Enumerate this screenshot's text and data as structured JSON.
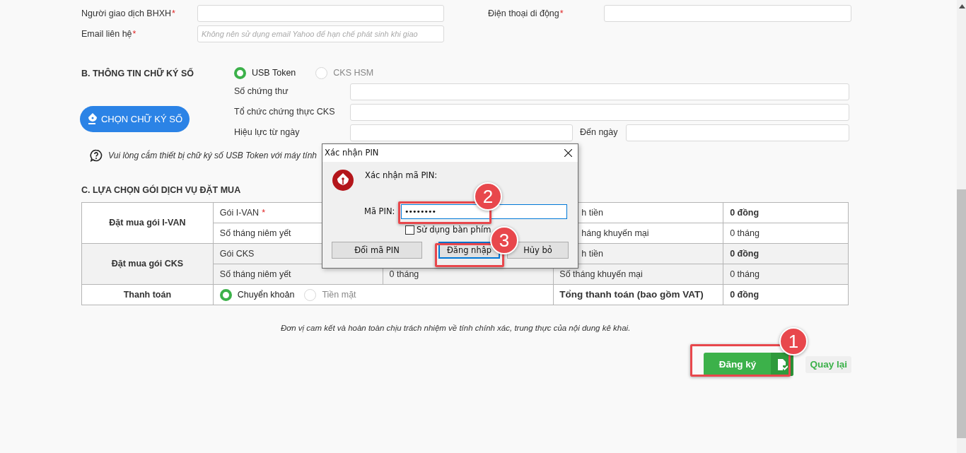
{
  "contact": {
    "fields": [
      {
        "label": "Người giao dịch BHXH",
        "mark": "*"
      },
      {
        "label": "Điện thoại di động",
        "mark": "*"
      },
      {
        "label": "Email liên hệ",
        "mark": "*",
        "placeholder": "Không nên sử dụng email Yahoo để hạn chế phát sinh khi giao"
      }
    ]
  },
  "signature": {
    "title": "B. THÔNG TIN CHỮ KÝ SỐ",
    "options": [
      {
        "label": "USB Token",
        "selected": true
      },
      {
        "label": "CKS HSM",
        "selected": false
      }
    ],
    "choose_button": "CHỌN CHỮ KÝ SỐ",
    "fields": [
      "Số chứng thư",
      "Tổ chức chứng thực CKS",
      "Hiệu lực từ ngày"
    ],
    "to_label": "Đến ngày",
    "note": "Vui lòng cắm thiết bị chữ ký số USB Token với máy tính"
  },
  "packages": {
    "title": "C. LỰA CHỌN GÓI DỊCH VỤ ĐẶT MUA",
    "groups": [
      {
        "title": "Đặt mua gói I-VAN",
        "lines": [
          {
            "label": "Gói I-VAN",
            "mark": "*",
            "label_2": "h tiền",
            "value_2": "0 đồng",
            "kind": "money"
          },
          {
            "label": "Số tháng niêm yết",
            "label_2": "háng khuyến mại",
            "value_2": "0 tháng",
            "kind": "months"
          }
        ]
      },
      {
        "title": "Đặt mua gói CKS",
        "lines": [
          {
            "label": "Gói CKS",
            "label_2": "h tiền",
            "value_2": "0 đồng",
            "kind": "money"
          },
          {
            "label": "Số tháng niêm yết",
            "value": "0 tháng",
            "label_2": "Số tháng khuyến mại",
            "value_2": "0 tháng",
            "kind": "months"
          }
        ]
      }
    ],
    "payment": {
      "title": "Thanh toán",
      "options": [
        {
          "label": "Chuyển khoản",
          "selected": true
        },
        {
          "label": "Tiền mặt",
          "selected": false
        }
      ],
      "total_label": "Tổng thanh toán (bao gồm VAT)",
      "total_value": "0 đồng"
    }
  },
  "commitment": "Đơn vị cam kết và hoàn toàn chịu trách nhiệm về tính chính xác, trung thực của nội dung kê khai.",
  "actions": {
    "register": "Đăng ký",
    "back": "Quay lại"
  },
  "dialog": {
    "title": "Xác nhận PIN",
    "prompt": "Xác nhận mã PIN:",
    "pin_label": "Mã PIN:",
    "pin_value": "••••••••",
    "virtual_keyboard": {
      "label": "Sử dụng bàn phím",
      "checked": false
    },
    "buttons": [
      {
        "label": "Đổi mã PIN",
        "default": false
      },
      {
        "label": "Đăng nhập",
        "default": true
      },
      {
        "label": "Hủy bỏ",
        "default": false
      }
    ]
  },
  "annotations": [
    {
      "number": "1"
    },
    {
      "number": "2"
    },
    {
      "number": "3"
    }
  ]
}
